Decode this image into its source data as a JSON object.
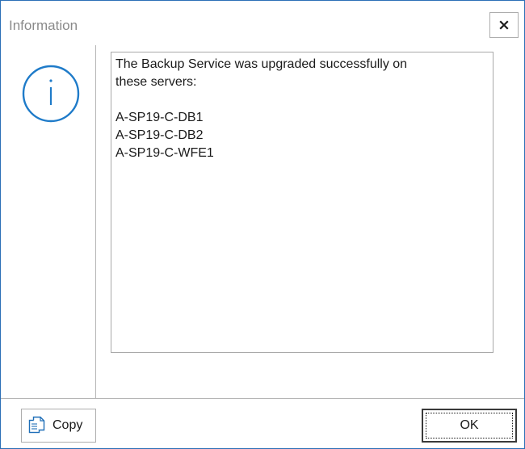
{
  "window": {
    "title": "Information"
  },
  "icons": {
    "close": "close-icon",
    "info": "info-icon",
    "copy": "copy-icon"
  },
  "message": {
    "lines": [
      "The Backup Service was upgraded successfully on",
      "these servers:",
      "",
      "A-SP19-C-DB1",
      "A-SP19-C-DB2",
      "A-SP19-C-WFE1"
    ]
  },
  "buttons": {
    "copy_label": "Copy",
    "ok_label": "OK"
  },
  "colors": {
    "accent": "#2b6fb6",
    "info_icon": "#1f7bc9"
  }
}
